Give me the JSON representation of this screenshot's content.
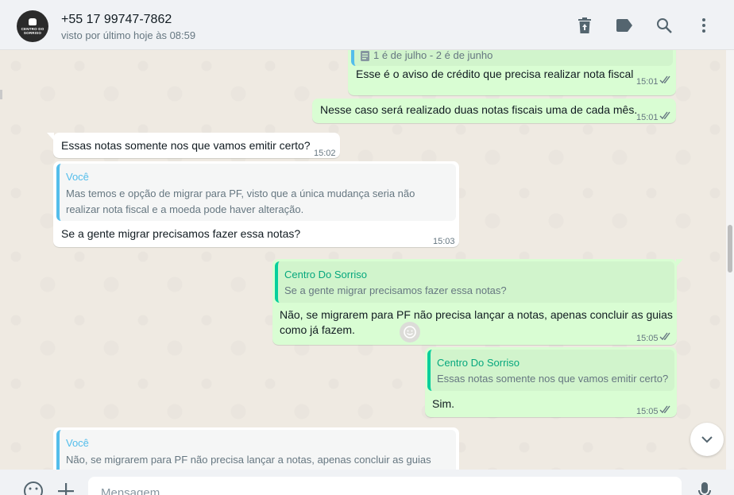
{
  "header": {
    "contact_name": "+55 17 99747-7862",
    "status": "visto por último hoje às 08:59",
    "avatar_text_1": "CENTRO DO",
    "avatar_text_2": "SORRISO",
    "icons": [
      "delete-icon",
      "label-icon",
      "search-icon",
      "menu-icon"
    ]
  },
  "messages": [
    {
      "id": "m0",
      "dir": "out",
      "doc_label": "1 é de julho - 2 é de junho",
      "text": "Esse é o aviso de crédito que precisa realizar nota fiscal",
      "time": "15:01"
    },
    {
      "id": "m1",
      "dir": "out",
      "text": "Nesse caso será realizado duas notas fiscais uma de cada mês.",
      "time": "15:01"
    },
    {
      "id": "m2",
      "dir": "in",
      "text": "Essas notas somente nos que vamos emitir certo?",
      "time": "15:02"
    },
    {
      "id": "m3",
      "dir": "in",
      "quote_author": "Você",
      "quote_line1": "Mas temos e opção de migrar para PF, visto que a única mudança seria não",
      "quote_line2": "realizar nota fiscal e a moeda pode haver alteração.",
      "text": "Se a gente migrar precisamos fazer essa notas?",
      "time": "15:03"
    },
    {
      "id": "m4",
      "dir": "out",
      "quote_author": "Centro Do Sorriso",
      "quote_line1": "Se a gente migrar precisamos fazer essa notas?",
      "text_line1": "Não, se migrarem para PF não precisa lançar a notas, apenas concluir as guias",
      "text_line2": "como já fazem.",
      "time": "15:05"
    },
    {
      "id": "m5",
      "dir": "out",
      "quote_author": "Centro Do Sorriso",
      "quote_line1": "Essas notas somente nos que vamos emitir certo?",
      "text": "Sim.",
      "time": "15:05"
    },
    {
      "id": "m6",
      "dir": "in",
      "quote_author": "Você",
      "quote_line1": "Não, se migrarem para PF não precisa lançar a notas, apenas concluir as guias"
    }
  ],
  "composer": {
    "placeholder": "Mensagem"
  },
  "colors": {
    "outgoing_bubble": "#d9fdd3",
    "incoming_bubble": "#ffffff",
    "quote_green": "#06cf9c",
    "quote_blue": "#53bdeb",
    "read_ticks": "#667781"
  }
}
